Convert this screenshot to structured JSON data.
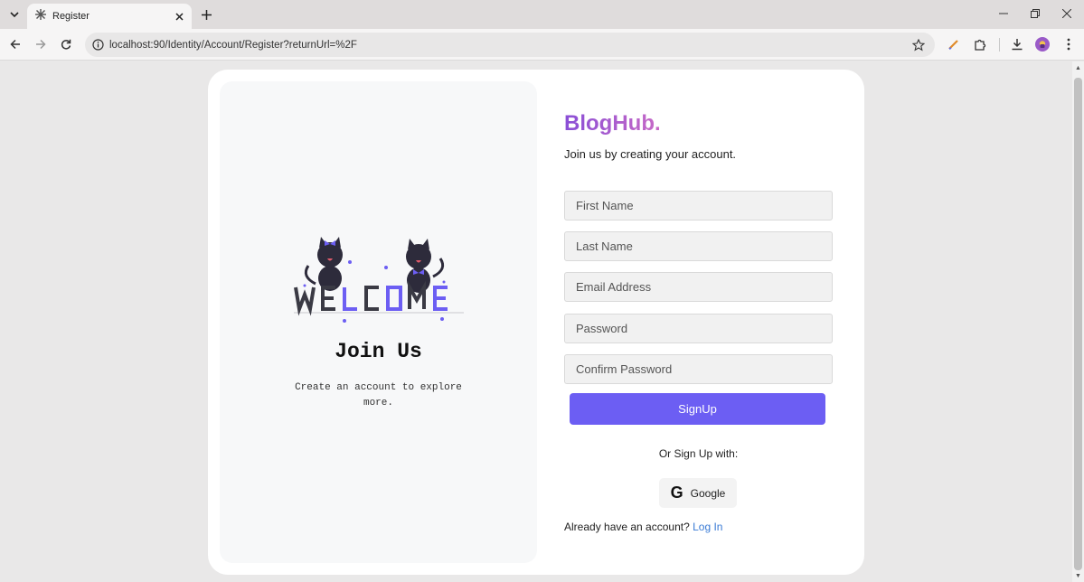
{
  "browser": {
    "tab_title": "Register",
    "url": "localhost:90/Identity/Account/Register?returnUrl=%2F"
  },
  "page": {
    "welcome_art_text": "WELCOME",
    "join_title": "Join Us",
    "join_subtitle": "Create an account to explore more.",
    "brand": "BlogHub.",
    "tagline": "Join us by creating your account.",
    "fields": {
      "first_name": "First Name",
      "last_name": "Last Name",
      "email": "Email Address",
      "password": "Password",
      "confirm_password": "Confirm Password"
    },
    "signup_label": "SignUp",
    "alt_signup_text": "Or Sign Up with:",
    "google_label": "Google",
    "has_account_text": "Already have an account?",
    "login_label": "Log In"
  },
  "colors": {
    "accent": "#6c5ef3",
    "link": "#3a7bd5",
    "brand_start": "#8a4fd6",
    "brand_end": "#c86ac6"
  },
  "icons": [
    "tab-search-icon",
    "favicon-icon",
    "close-icon",
    "plus-icon",
    "minimize-icon",
    "restore-icon",
    "window-close-icon",
    "back-icon",
    "forward-icon",
    "reload-icon",
    "info-icon",
    "star-icon",
    "pen-icon",
    "extensions-icon",
    "download-icon",
    "profile-icon",
    "menu-icon",
    "google-icon"
  ]
}
